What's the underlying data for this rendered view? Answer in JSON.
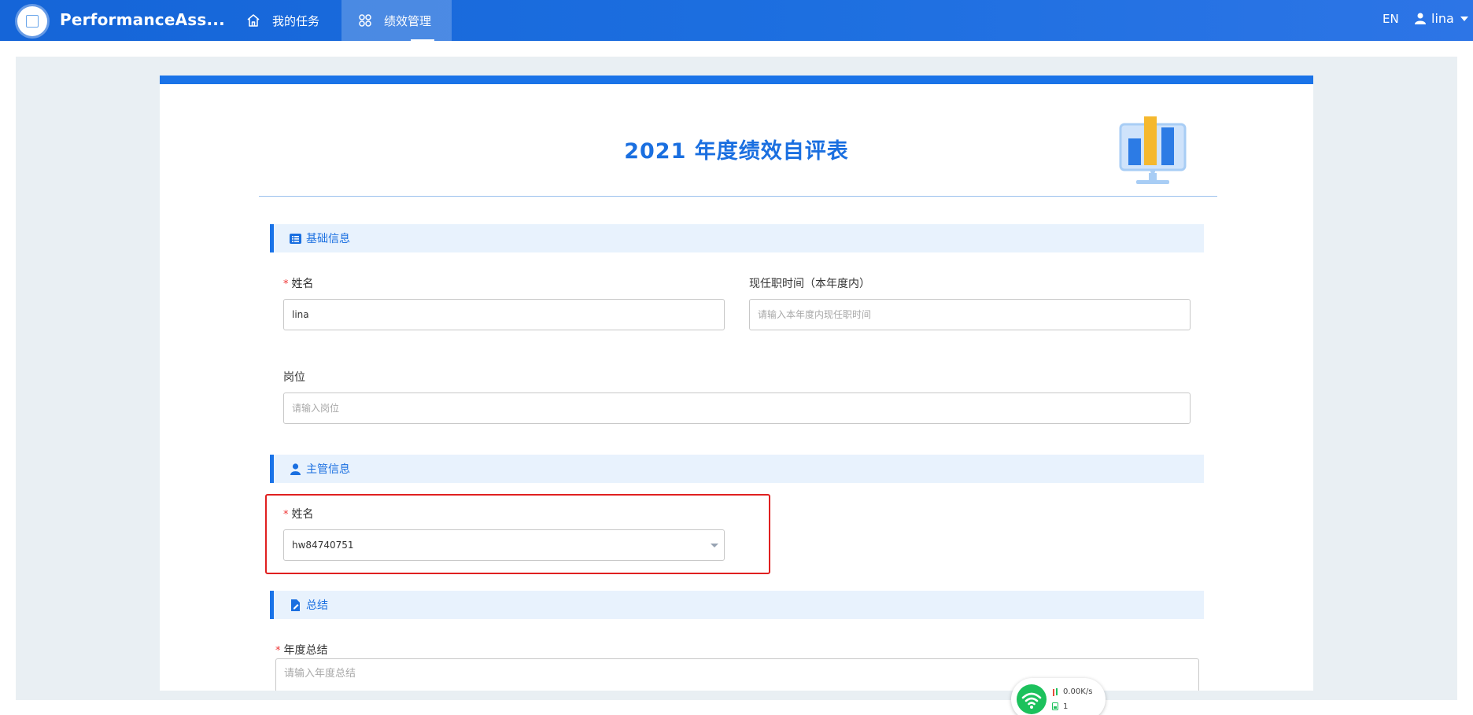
{
  "app": {
    "title": "PerformanceAss..."
  },
  "nav": {
    "tasks_label": "我的任务",
    "performance_label": "绩效管理"
  },
  "header_right": {
    "language": "EN",
    "username": "lina"
  },
  "form": {
    "title": "2021 年度绩效自评表",
    "sections": {
      "basic": "基础信息",
      "manager": "主管信息",
      "summary": "总结"
    },
    "basic": {
      "name_label": "姓名",
      "name_value": "lina",
      "tenure_label": "现任职时间（本年度内）",
      "tenure_placeholder": "请输入本年度内现任职时间",
      "position_label": "岗位",
      "position_placeholder": "请输入岗位"
    },
    "manager": {
      "name_label": "姓名",
      "name_value": "hw84740751"
    },
    "summary": {
      "annual_label": "年度总结",
      "annual_placeholder": "请输入年度总结"
    },
    "required_mark": "*"
  },
  "network_widget": {
    "speed": "0.00K/s",
    "count": "1"
  },
  "colors": {
    "primary": "#1a73e8",
    "section_bg": "#e8f2fd",
    "highlight_border": "#e02020",
    "required": "#ee3333"
  }
}
